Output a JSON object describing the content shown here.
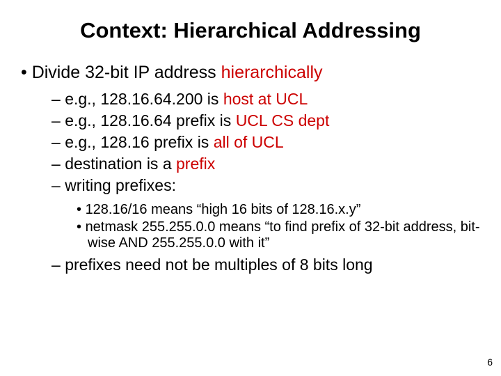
{
  "title": "Context: Hierarchical Addressing",
  "b1": {
    "pre": "Divide 32-bit IP address ",
    "hl": "hierarchically"
  },
  "b2": [
    {
      "pre": "e.g., 128.16.64.200 is ",
      "hl": "host at UCL",
      "post": ""
    },
    {
      "pre": "e.g., 128.16.64 prefix is ",
      "hl": "UCL CS dept",
      "post": ""
    },
    {
      "pre": "e.g., 128.16 prefix is ",
      "hl": "all of UCL",
      "post": ""
    },
    {
      "pre": "destination is a ",
      "hl": "prefix",
      "post": ""
    },
    {
      "pre": "writing prefixes:",
      "hl": "",
      "post": ""
    }
  ],
  "b3": [
    "128.16/16 means “high 16 bits of 128.16.x.y”",
    "netmask 255.255.0.0 means “to find prefix of 32-bit address, bit-wise AND 255.255.0.0 with it”"
  ],
  "b2_last": "prefixes need not be multiples of 8 bits long",
  "page": "6"
}
